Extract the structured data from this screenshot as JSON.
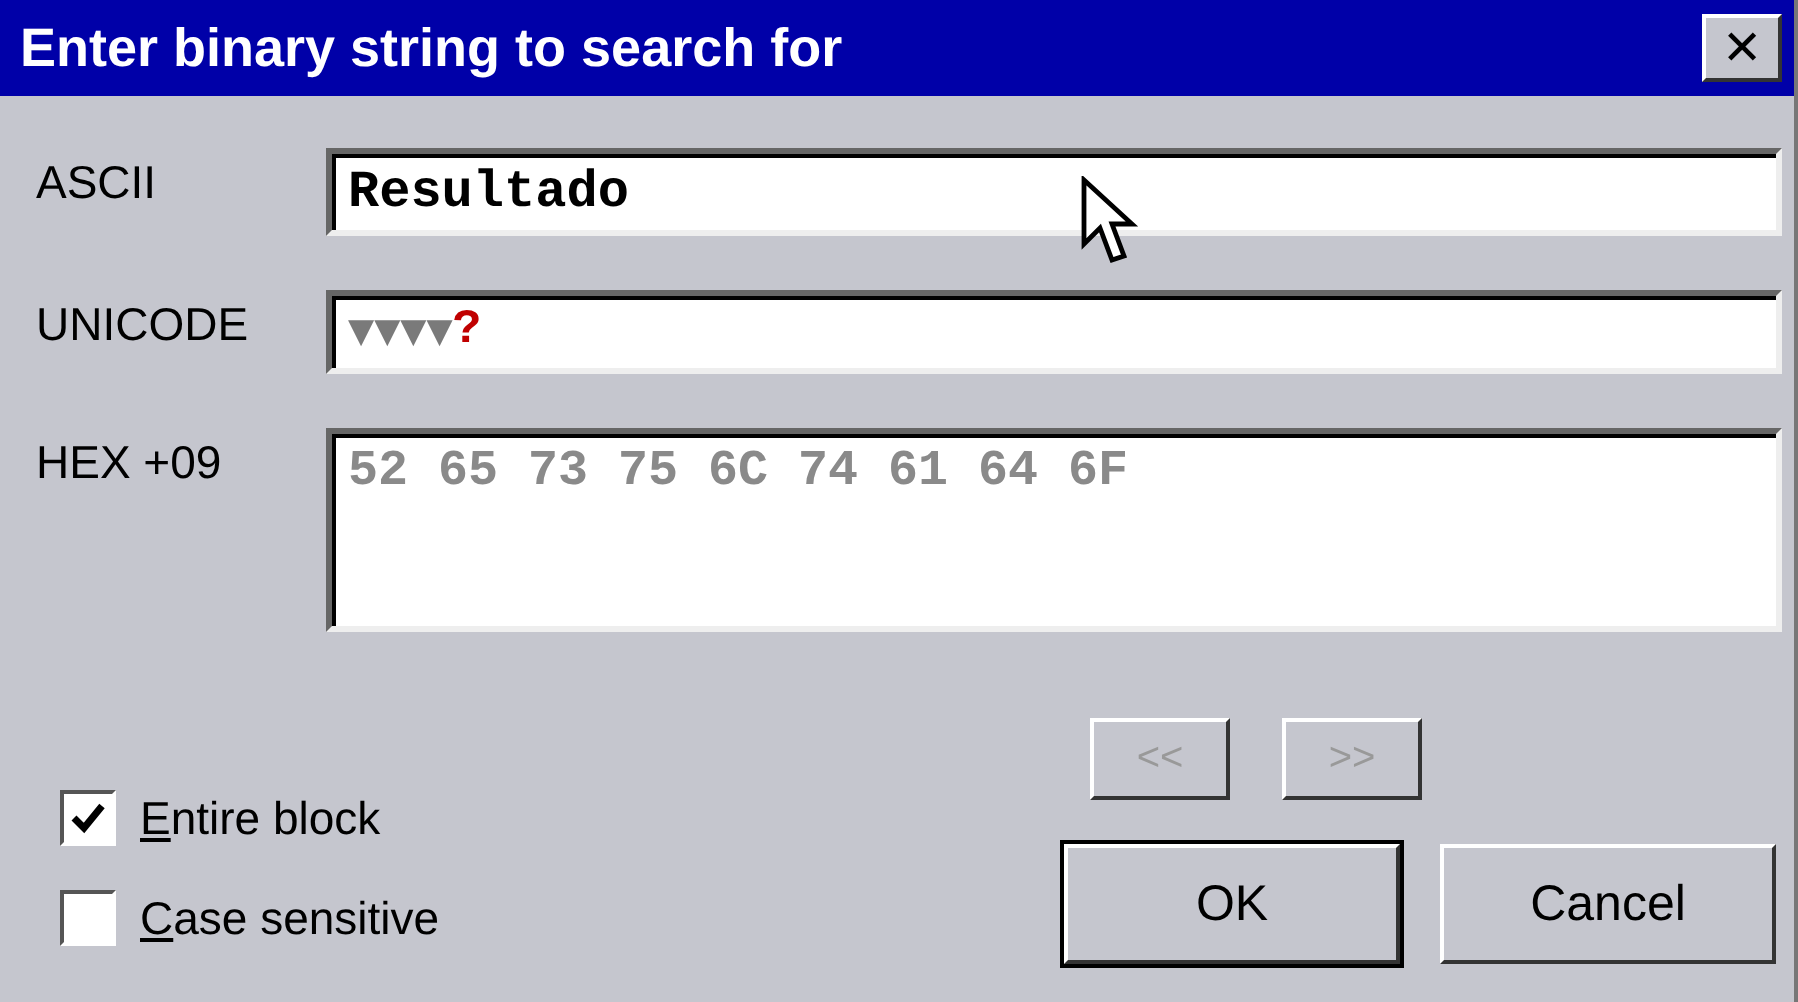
{
  "window": {
    "title": "Enter binary string to search for",
    "close": "✕"
  },
  "fields": [
    {
      "kind": "line",
      "label": "ASCII",
      "value": "Resultado"
    },
    {
      "kind": "unicode",
      "label": "UNICODE",
      "value": "▼▼▼▼",
      "invalid": "?"
    },
    {
      "kind": "area",
      "label": "HEX +09",
      "value": "52 65 73 75 6C 74 61 64 6F"
    }
  ],
  "checkboxes": [
    {
      "label": "Entire block",
      "checked": true
    },
    {
      "label": "Case sensitive",
      "checked": false
    }
  ],
  "nav_buttons": [
    {
      "label": "<<",
      "disabled": true
    },
    {
      "label": ">>",
      "disabled": true
    }
  ],
  "buttons": [
    {
      "label": "OK",
      "default": true
    },
    {
      "label": "Cancel",
      "default": false
    }
  ]
}
